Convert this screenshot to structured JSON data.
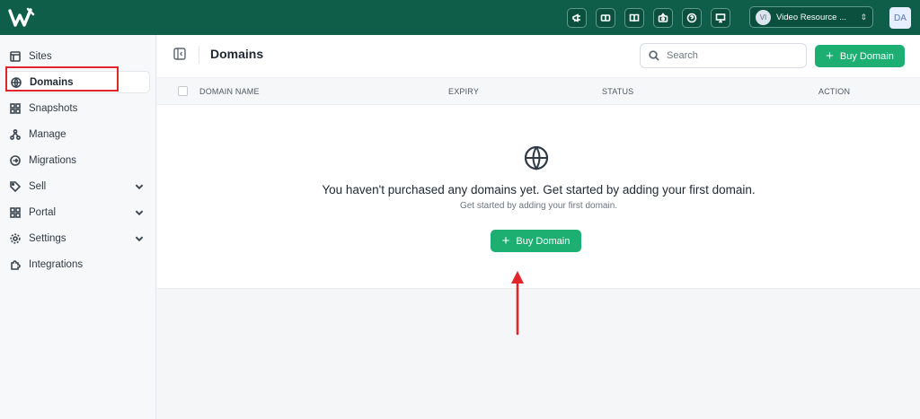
{
  "topbar": {
    "brand_color": "#0e5e4a",
    "icons": [
      "megaphone-icon",
      "ticket-icon",
      "book-icon",
      "video-camera-icon",
      "help-icon",
      "presentation-icon"
    ],
    "account": {
      "avatar_initials": "VI",
      "name": "Video Resource ..."
    },
    "user_initials": "DA"
  },
  "sidebar": {
    "items": [
      {
        "label": "Sites",
        "icon": "layout-icon"
      },
      {
        "label": "Domains",
        "icon": "globe-icon",
        "active": true
      },
      {
        "label": "Snapshots",
        "icon": "grid-icon"
      },
      {
        "label": "Manage",
        "icon": "hierarchy-icon"
      },
      {
        "label": "Migrations",
        "icon": "arrow-circle-icon"
      },
      {
        "label": "Sell",
        "icon": "tag-icon",
        "expandable": true
      },
      {
        "label": "Portal",
        "icon": "grid-icon",
        "expandable": true
      },
      {
        "label": "Settings",
        "icon": "gear-icon",
        "expandable": true
      },
      {
        "label": "Integrations",
        "icon": "puzzle-icon"
      }
    ]
  },
  "header": {
    "title": "Domains",
    "search_placeholder": "Search",
    "buy_label": "Buy Domain"
  },
  "table": {
    "columns": [
      "DOMAIN NAME",
      "EXPIRY",
      "STATUS",
      "ACTION"
    ]
  },
  "empty_state": {
    "title": "You haven't purchased any domains yet. Get started by adding your first domain.",
    "subtitle": "Get started by adding your first domain.",
    "button_label": "Buy Domain"
  },
  "colors": {
    "accent": "#1dae72",
    "annotation": "#e0262b"
  }
}
